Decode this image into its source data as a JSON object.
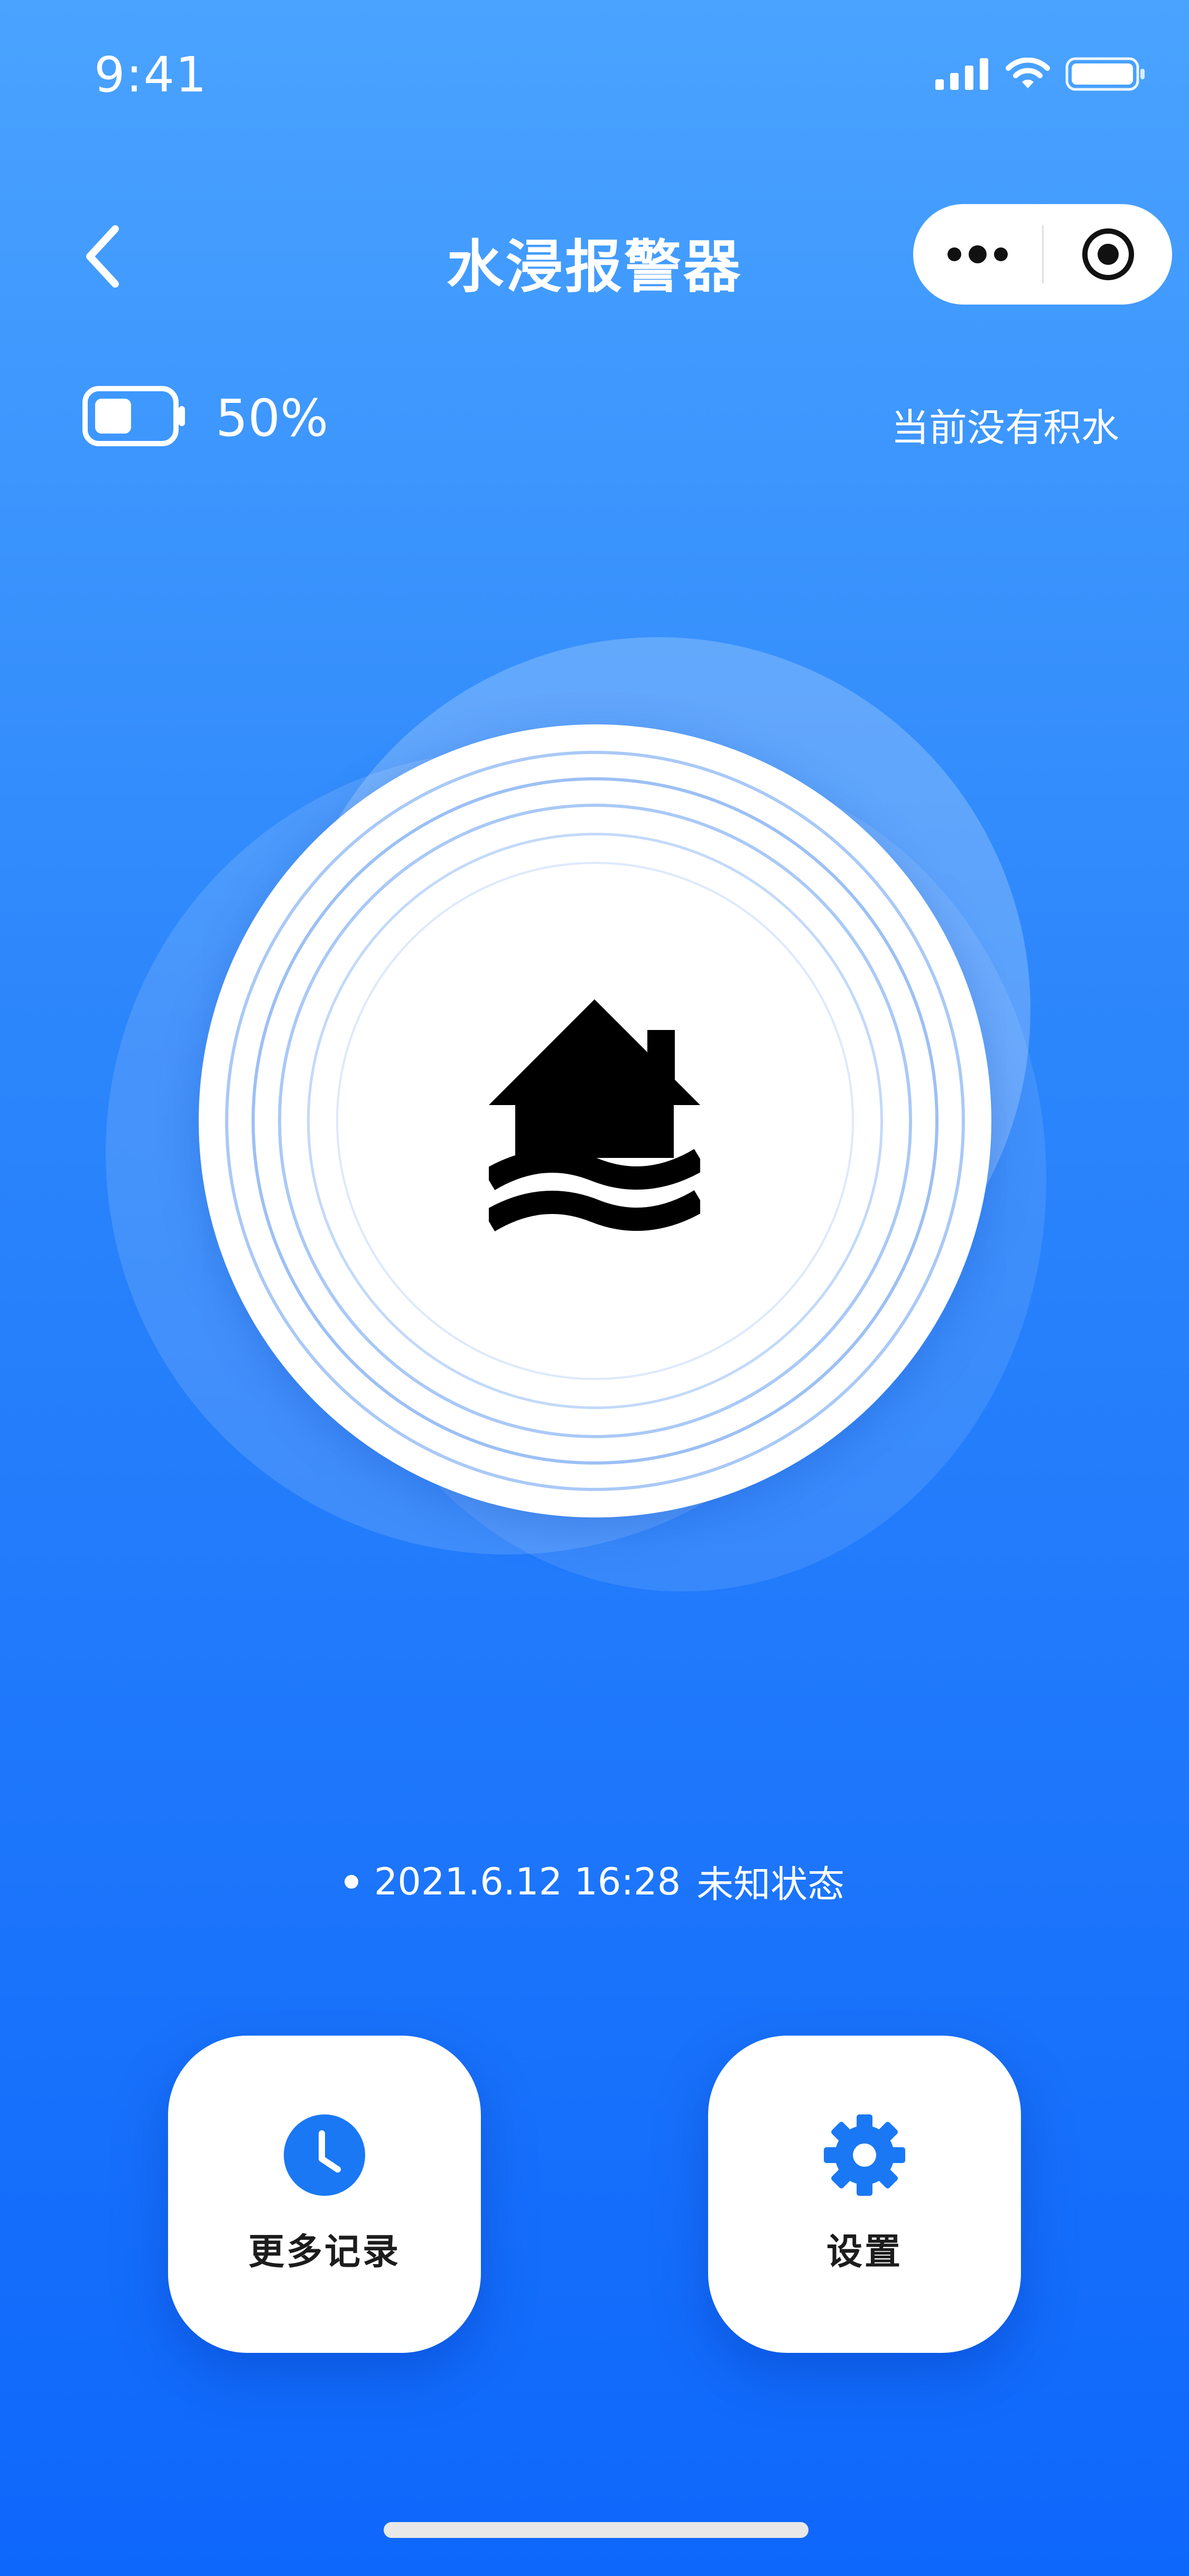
{
  "status_bar": {
    "time": "9:41"
  },
  "nav": {
    "title": "水浸报警器"
  },
  "device": {
    "battery_percent": "50%",
    "battery_level": 0.5,
    "water_status": "当前没有积水",
    "last_record_datetime": "2021.6.12 16:28",
    "last_record_status": "未知状态"
  },
  "actions": {
    "records_label": "更多记录",
    "settings_label": "设置"
  },
  "icons": {
    "back": "chevron-left-icon",
    "more": "more-dots-icon",
    "close": "target-circle-icon",
    "battery": "battery-icon",
    "flood": "house-flood-icon",
    "clock": "clock-icon",
    "settings": "gear-icon"
  },
  "colors": {
    "accent": "#1a78f5",
    "background_top": "#4aa3ff",
    "background_bottom": "#0e67fb"
  }
}
